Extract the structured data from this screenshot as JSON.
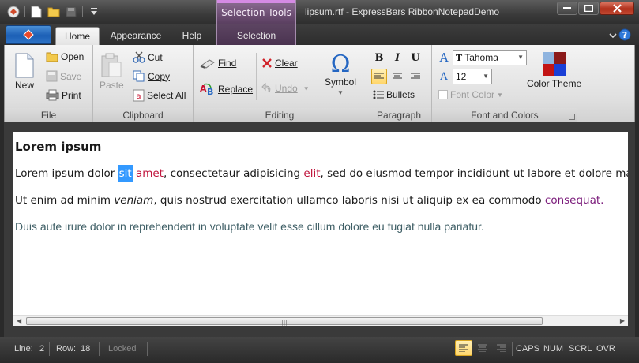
{
  "window": {
    "title": "lipsum.rtf - ExpressBars RibbonNotepadDemo",
    "context_header": "Selection Tools"
  },
  "tabs": [
    {
      "label": "Home",
      "active": true
    },
    {
      "label": "Appearance"
    },
    {
      "label": "Help"
    },
    {
      "label": "Selection",
      "contextual": true
    }
  ],
  "ribbon": {
    "file": {
      "label": "File",
      "new": "New",
      "open": "Open",
      "save": "Save",
      "print": "Print"
    },
    "clipboard": {
      "label": "Clipboard",
      "paste": "Paste",
      "cut": "Cut",
      "copy": "Copy",
      "select_all": "Select All"
    },
    "editing": {
      "label": "Editing",
      "find": "Find",
      "replace": "Replace",
      "clear": "Clear",
      "undo": "Undo",
      "symbol": "Symbol"
    },
    "paragraph": {
      "label": "Paragraph",
      "bullets": "Bullets",
      "bold": "B",
      "italic": "I",
      "underline": "U"
    },
    "font": {
      "label": "Font and Colors",
      "font_name": "Tahoma",
      "font_size": "12",
      "font_color": "Font Color",
      "color_theme": "Color Theme"
    }
  },
  "document": {
    "heading": "Lorem ipsum",
    "line1": {
      "pre": "Lorem ipsum dolor ",
      "selected": "sit",
      "red1": " amet",
      "mid": ", consectetaur adipisicing ",
      "red2": "elit",
      "post": ", sed do eiusmod tempor incididunt ut labore et dolore magna aliqua."
    },
    "line2": {
      "pre": "Ut enim ad minim ",
      "italic": "veniam",
      "mid": ", quis nostrud exercitation ullamco laboris nisi ut aliquip ex ea commodo ",
      "purple": "consequat."
    },
    "line3": "Duis aute irure dolor in reprehenderit in voluptate velit esse cillum dolore eu fugiat nulla pariatur."
  },
  "status": {
    "line_label": "Line:",
    "line": "2",
    "row_label": "Row:",
    "row": "18",
    "locked": "Locked",
    "caps": "CAPS",
    "num": "NUM",
    "scrl": "SCRL",
    "ovr": "OVR"
  },
  "colors": {
    "selection": "#3399ff",
    "accent_red": "#c0143c",
    "context_tab": "#8e6f95"
  }
}
